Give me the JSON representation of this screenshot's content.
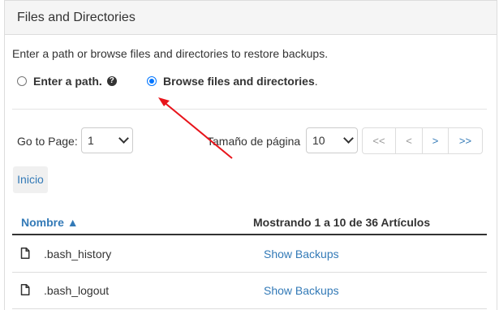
{
  "panel": {
    "title": "Files and Directories"
  },
  "intro": "Enter a path or browse files and directories to restore backups.",
  "mode": {
    "enter_path_label": "Enter a path.",
    "browse_label": "Browse files and directories",
    "browse_suffix": ".",
    "selected": "browse"
  },
  "pagination": {
    "goto_label": "Go to Page:",
    "goto_value": "1",
    "page_size_label": "Tamaño de página",
    "page_size_value": "10",
    "buttons": [
      "<<",
      "<",
      ">",
      ">>"
    ]
  },
  "breadcrumb": {
    "home": "Inicio"
  },
  "table": {
    "col_name": "Nombre ▲",
    "status": "Mostrando 1 a 10 de 36 Artículos",
    "rows": [
      {
        "name": ".bash_history",
        "action": "Show Backups"
      },
      {
        "name": ".bash_logout",
        "action": "Show Backups"
      }
    ]
  },
  "colors": {
    "accent": "#337ab7",
    "radio": "#0075ff",
    "annotation_arrow": "#e8141b"
  }
}
